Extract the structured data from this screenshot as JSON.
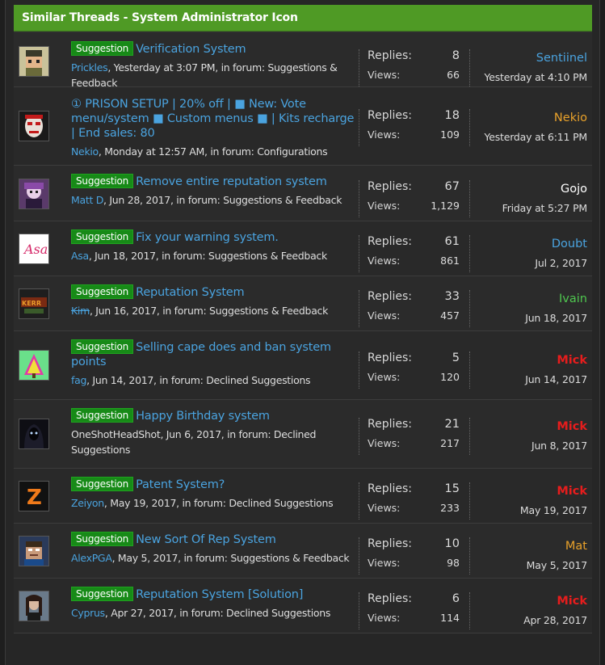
{
  "header": {
    "title": "Similar Threads - System Administrator Icon"
  },
  "threads": [
    {
      "tag": "Suggestion",
      "title": "Verification System",
      "user": "Prickles",
      "meta": ", Yesterday at 3:07 PM, in forum: Suggestions & Feedback",
      "replies_label": "Replies:",
      "replies": "8",
      "views_label": "Views:",
      "views": "66",
      "last_user": "Sentiinel",
      "last_date": "Yesterday at 4:10 PM",
      "avatar": "avatar-pixel"
    },
    {
      "tag": "",
      "title": "① PRISON SETUP | 20% off | ■ New: Vote menu/system ■ Custom menus ■ | Kits recharge | End sales: 80",
      "user": "Nekio",
      "meta": ", Monday at 12:57 AM, in forum: Configurations",
      "replies_label": "Replies:",
      "replies": "18",
      "views_label": "Views:",
      "views": "109",
      "last_user": "Nekio",
      "last_date": "Yesterday at 6:11 PM",
      "avatar": "avatar-mask"
    },
    {
      "tag": "Suggestion",
      "title": "Remove entire reputation system",
      "user": "Matt D",
      "meta": ", Jun 28, 2017, in forum: Suggestions & Feedback",
      "replies_label": "Replies:",
      "replies": "67",
      "views_label": "Views:",
      "views": "1,129",
      "last_user": "Gojo",
      "last_date": "Friday at 5:27 PM",
      "avatar": "avatar-anime"
    },
    {
      "tag": "Suggestion",
      "title": "Fix your warning system.",
      "user": "Asa",
      "meta": ", Jun 18, 2017, in forum: Suggestions & Feedback",
      "replies_label": "Replies:",
      "replies": "61",
      "views_label": "Views:",
      "views": "861",
      "last_user": "Doubt",
      "last_date": "Jul 2, 2017",
      "avatar": "avatar-asa"
    },
    {
      "tag": "Suggestion",
      "title": "Reputation System",
      "user": "Kim",
      "meta": ", Jun 16, 2017, in forum: Suggestions & Feedback",
      "replies_label": "Replies:",
      "replies": "33",
      "views_label": "Views:",
      "views": "457",
      "last_user": "Ivain",
      "last_date": "Jun 18, 2017",
      "avatar": "avatar-kerrrs"
    },
    {
      "tag": "Suggestion",
      "title": "Selling cape does and ban system points",
      "user": "fag",
      "meta": ", Jun 14, 2017, in forum: Declined Suggestions",
      "replies_label": "Replies:",
      "replies": "5",
      "views_label": "Views:",
      "views": "120",
      "last_user": "Mick",
      "last_date": "Jun 14, 2017",
      "avatar": "avatar-tree"
    },
    {
      "tag": "Suggestion",
      "title": "Happy Birthday system",
      "user": "OneShotHeadShot",
      "meta": ", Jun 6, 2017, in forum: Declined Suggestions",
      "replies_label": "Replies:",
      "replies": "21",
      "views_label": "Views:",
      "views": "217",
      "last_user": "Mick",
      "last_date": "Jun 8, 2017",
      "avatar": "avatar-hood"
    },
    {
      "tag": "Suggestion",
      "title": "Patent System?",
      "user": "Zeiyon",
      "meta": ", May 19, 2017, in forum: Declined Suggestions",
      "replies_label": "Replies:",
      "replies": "15",
      "views_label": "Views:",
      "views": "233",
      "last_user": "Mick",
      "last_date": "May 19, 2017",
      "avatar": "avatar-z"
    },
    {
      "tag": "Suggestion",
      "title": "New Sort Of Rep System",
      "user": "AlexPGA",
      "meta": ", May 5, 2017, in forum: Suggestions & Feedback",
      "replies_label": "Replies:",
      "replies": "10",
      "views_label": "Views:",
      "views": "98",
      "last_user": "Mat",
      "last_date": "May 5, 2017",
      "avatar": "avatar-minecraft"
    },
    {
      "tag": "Suggestion",
      "title": "Reputation System [Solution]",
      "user": "Cyprus",
      "meta": ", Apr 27, 2017, in forum: Declined Suggestions",
      "replies_label": "Replies:",
      "replies": "6",
      "views_label": "Views:",
      "views": "114",
      "last_user": "Mick",
      "last_date": "Apr 28, 2017",
      "avatar": "avatar-photo"
    }
  ]
}
